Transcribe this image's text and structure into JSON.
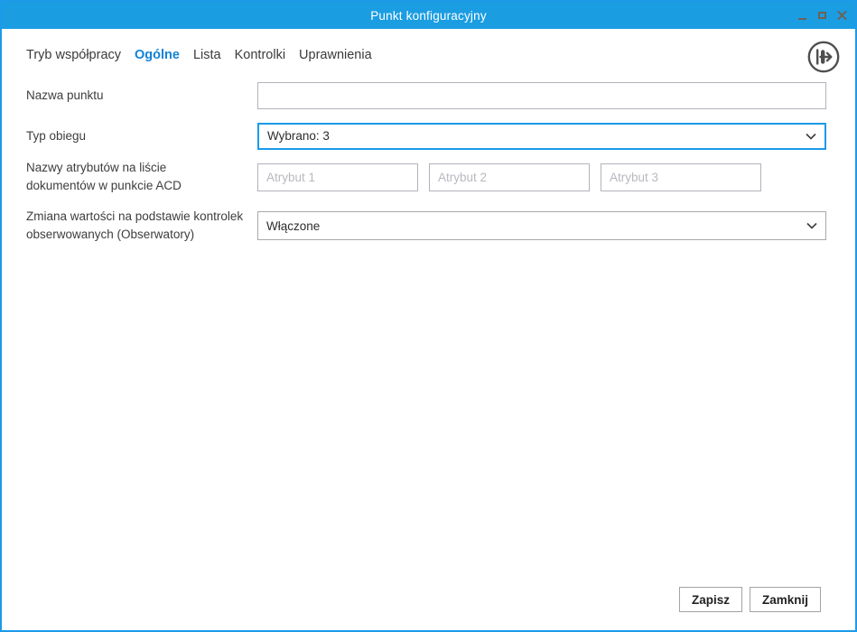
{
  "window": {
    "title": "Punkt konfiguracyjny"
  },
  "colors": {
    "titlebar_blue": "#1b9de2",
    "window_border_blue": "#1c9ae8",
    "active_tab_blue": "#1283d6",
    "focused_field_border": "#1c9ae8",
    "placeholder_gray": "#b8b8c0"
  },
  "tabs": [
    {
      "label": "Tryb współpracy",
      "active": false
    },
    {
      "label": "Ogólne",
      "active": true
    },
    {
      "label": "Lista",
      "active": false
    },
    {
      "label": "Kontrolki",
      "active": false
    },
    {
      "label": "Uprawnienia",
      "active": false
    }
  ],
  "form": {
    "nazwa_punktu": {
      "label": "Nazwa punktu",
      "value": ""
    },
    "typ_obiegu": {
      "label": "Typ obiegu",
      "value": "Wybrano: 3"
    },
    "atrybuty": {
      "label_line1": "Nazwy atrybutów na liście",
      "label_line2": "dokumentów w punkcie ACD",
      "placeholders": [
        "Atrybut 1",
        "Atrybut 2",
        "Atrybut 3"
      ],
      "values": [
        "",
        "",
        ""
      ]
    },
    "obserwatory": {
      "label_line1": "Zmiana wartości na podstawie kontrolek",
      "label_line2": "obserwowanych (Obserwatory)",
      "value": "Włączone"
    }
  },
  "footer": {
    "save_label": "Zapisz",
    "close_label": "Zamknij"
  }
}
